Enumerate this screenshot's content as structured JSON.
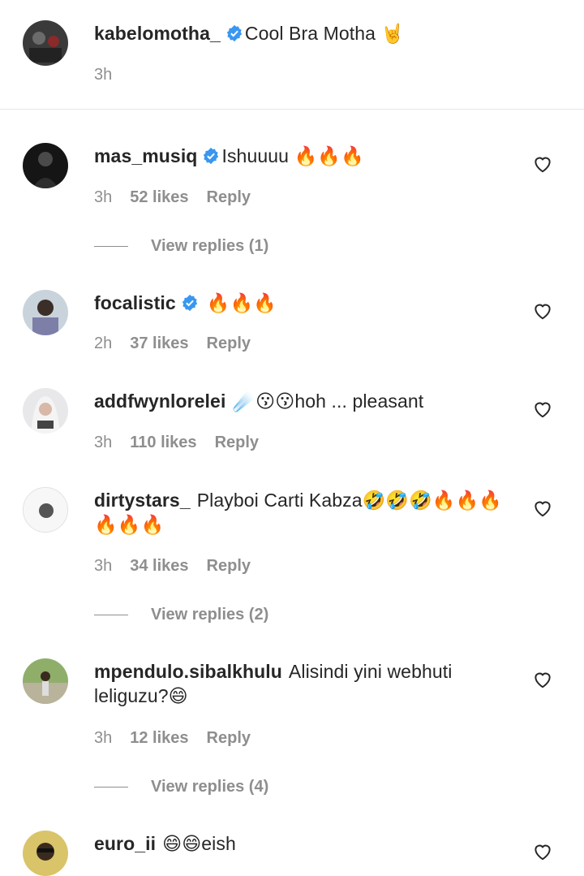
{
  "caption": {
    "username": "kabelomotha_",
    "verified": true,
    "text": "Cool Bra Motha 🤘",
    "time": "3h"
  },
  "comments": [
    {
      "username": "mas_musiq",
      "verified": true,
      "text": "Ishuuuu 🔥🔥🔥",
      "time": "3h",
      "likes": "52 likes",
      "reply": "Reply",
      "view_replies": "View replies (1)"
    },
    {
      "username": "focalistic",
      "verified": true,
      "text": "🔥🔥🔥",
      "time": "2h",
      "likes": "37 likes",
      "reply": "Reply"
    },
    {
      "username": "addfwynlorelei",
      "verified": false,
      "text": "☄️😗😗hoh ... pleasant",
      "time": "3h",
      "likes": "110 likes",
      "reply": "Reply"
    },
    {
      "username": "dirtystars_",
      "verified": false,
      "text": "Playboi Carti Kabza🤣🤣🤣🔥🔥🔥🔥🔥🔥",
      "time": "3h",
      "likes": "34 likes",
      "reply": "Reply",
      "view_replies": "View replies (2)"
    },
    {
      "username": "mpendulo.sibalkhulu",
      "verified": false,
      "text": "Alisindi yini webhuti leliguzu?😄",
      "time": "3h",
      "likes": "12 likes",
      "reply": "Reply",
      "view_replies": "View replies (4)"
    },
    {
      "username": "euro_ii",
      "verified": false,
      "text": "😄😄eish"
    }
  ],
  "colors": {
    "text": "#262626",
    "secondary": "#8e8e8e",
    "verified": "#3897f0",
    "divider": "#e6e6e6"
  },
  "icons": {
    "like": "heart-outline-icon",
    "verified": "verified-badge-icon"
  }
}
